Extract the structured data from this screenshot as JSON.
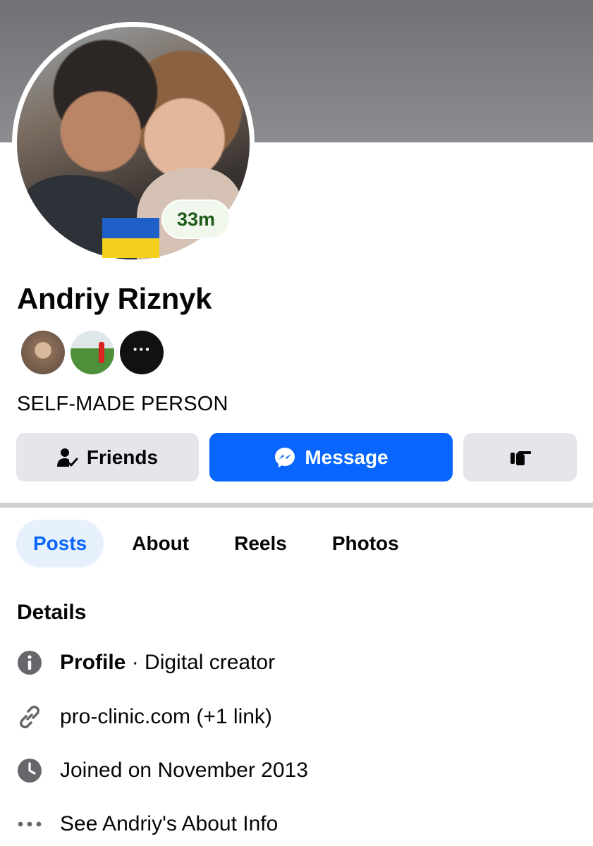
{
  "profile": {
    "name": "Andriy Riznyk",
    "status_time": "33m",
    "bio": "SELF-MADE PERSON",
    "mini_avatars_more": "···"
  },
  "actions": {
    "friends_label": "Friends",
    "message_label": "Message"
  },
  "tabs": [
    {
      "label": "Posts",
      "active": true
    },
    {
      "label": "About",
      "active": false
    },
    {
      "label": "Reels",
      "active": false
    },
    {
      "label": "Photos",
      "active": false
    }
  ],
  "details": {
    "title": "Details",
    "profile_label": "Profile",
    "profile_sep": " · ",
    "profile_value": "Digital creator",
    "link_text": "pro-clinic.com (+1 link)",
    "joined_text": "Joined on November 2013",
    "about_text": "See Andriy's About Info"
  },
  "colors": {
    "accent": "#0866ff",
    "button_gray": "#e4e6eb",
    "status_green": "#1e5b1a"
  }
}
